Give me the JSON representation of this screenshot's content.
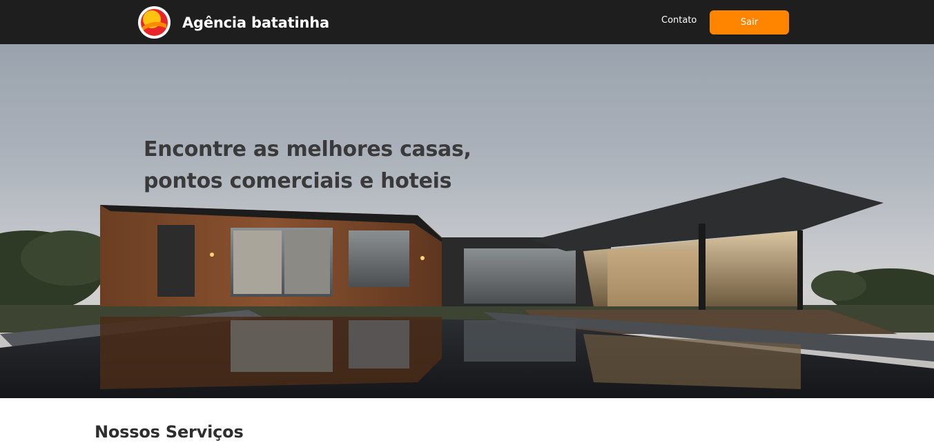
{
  "header": {
    "brand_name": "Agência batatinha",
    "nav_contact": "Contato",
    "logout_label": "Sair"
  },
  "hero": {
    "title_line1": "Encontre as melhores casas,",
    "title_line2": "pontos comerciais e hoteis"
  },
  "services": {
    "title": "Nossos Serviços"
  },
  "colors": {
    "navbar_bg": "#1e1e1e",
    "accent": "#ff8400",
    "logo_red": "#e8262a",
    "logo_yellow": "#ffc20e"
  },
  "icons": {
    "logo": "sun-logo-icon"
  }
}
